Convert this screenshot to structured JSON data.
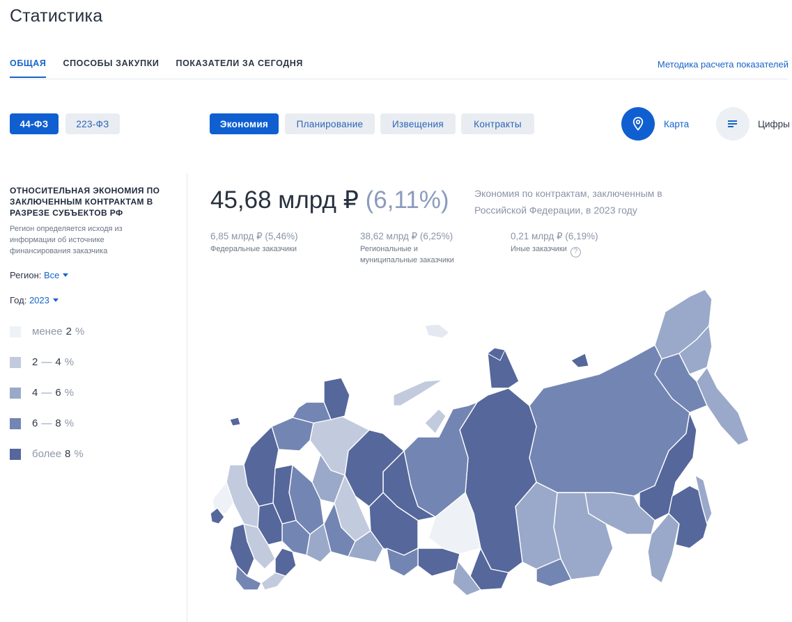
{
  "page": {
    "title": "Статистика"
  },
  "tabs": [
    {
      "label": "ОБЩАЯ",
      "active": true
    },
    {
      "label": "СПОСОБЫ ЗАКУПКИ",
      "active": false
    },
    {
      "label": "ПОКАЗАТЕЛИ ЗА СЕГОДНЯ",
      "active": false
    }
  ],
  "method_link": "Методика расчета показателей",
  "law_buttons": [
    {
      "label": "44-ФЗ",
      "active": true
    },
    {
      "label": "223-ФЗ",
      "active": false
    }
  ],
  "metric_buttons": [
    {
      "label": "Экономия",
      "active": true
    },
    {
      "label": "Планирование",
      "active": false
    },
    {
      "label": "Извещения",
      "active": false
    },
    {
      "label": "Контракты",
      "active": false
    }
  ],
  "view_toggle": {
    "map_label": "Карта",
    "numbers_label": "Цифры",
    "map_icon": "map-pin-icon",
    "numbers_icon": "list-lines-icon"
  },
  "sidebar": {
    "title": "ОТНОСИТЕЛЬНАЯ ЭКОНОМИЯ ПО ЗАКЛЮЧЕННЫМ КОНТРАКТАМ В РАЗРЕЗЕ СУБЪЕКТОВ РФ",
    "note": "Регион определяется исходя из информации об источнике финансирования заказчика",
    "region_label": "Регион:",
    "region_value": "Все",
    "year_label": "Год:",
    "year_value": "2023"
  },
  "legend": [
    {
      "prefix": "менее",
      "from": "2",
      "sep": "",
      "to": "",
      "unit": "%",
      "color": "#eef1f6"
    },
    {
      "prefix": "",
      "from": "2",
      "sep": "—",
      "to": "4",
      "unit": "%",
      "color": "#c2cade"
    },
    {
      "prefix": "",
      "from": "4",
      "sep": "—",
      "to": "6",
      "unit": "%",
      "color": "#9aa9c9"
    },
    {
      "prefix": "",
      "from": "6",
      "sep": "—",
      "to": "8",
      "unit": "%",
      "color": "#7385b3"
    },
    {
      "prefix": "более",
      "from": "8",
      "sep": "",
      "to": "",
      "unit": "%",
      "color": "#55679b"
    }
  ],
  "summary": {
    "value": "45,68 млрд ₽",
    "percent": "(6,11%)",
    "description": "Экономия по контрактам, заключенным в Российской Федерации, в 2023 году"
  },
  "breakdown": [
    {
      "value": "6,85 млрд ₽ (5,46%)",
      "label": "Федеральные заказчики"
    },
    {
      "value": "38,62 млрд ₽ (6,25%)",
      "label": "Региональные и муниципальные заказчики"
    },
    {
      "value": "0,21 млрд ₽ (6,19%)",
      "label": "Иные заказчики",
      "help_icon": "question-circle-icon",
      "help_text": "?"
    }
  ]
}
